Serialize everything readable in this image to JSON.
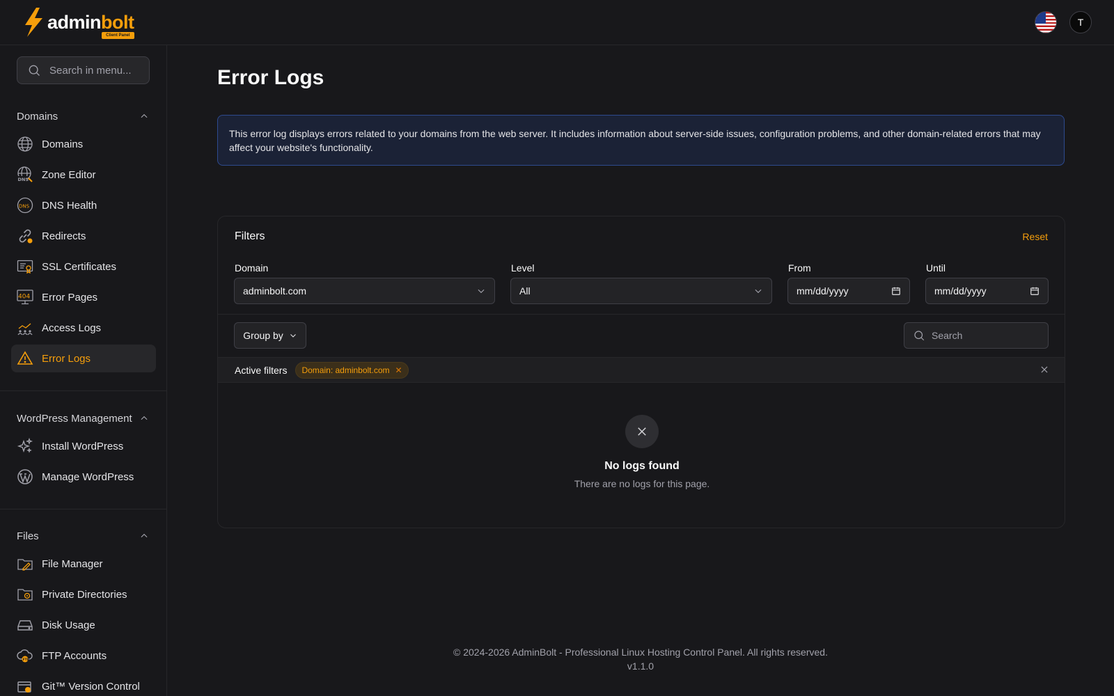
{
  "app": {
    "logo_part1": "admin",
    "logo_part2": "bolt",
    "logo_badge": "Client Panel",
    "avatar_initial": "T",
    "accent_color": "#f59e0b"
  },
  "sidebar": {
    "search_placeholder": "Search in menu...",
    "sections": [
      {
        "title": "Domains",
        "items": [
          {
            "label": "Domains",
            "icon": "globe-icon"
          },
          {
            "label": "Zone Editor",
            "icon": "dns-globe-icon"
          },
          {
            "label": "DNS Health",
            "icon": "dns-health-icon"
          },
          {
            "label": "Redirects",
            "icon": "link-icon"
          },
          {
            "label": "SSL Certificates",
            "icon": "certificate-icon"
          },
          {
            "label": "Error Pages",
            "icon": "error-404-icon"
          },
          {
            "label": "Access Logs",
            "icon": "access-chart-icon"
          },
          {
            "label": "Error Logs",
            "icon": "warning-icon",
            "active": true
          }
        ]
      },
      {
        "title": "WordPress Management",
        "items": [
          {
            "label": "Install WordPress",
            "icon": "sparkles-icon"
          },
          {
            "label": "Manage WordPress",
            "icon": "wordpress-icon"
          }
        ]
      },
      {
        "title": "Files",
        "items": [
          {
            "label": "File Manager",
            "icon": "folder-edit-icon"
          },
          {
            "label": "Private Directories",
            "icon": "folder-lock-icon"
          },
          {
            "label": "Disk Usage",
            "icon": "disk-icon"
          },
          {
            "label": "FTP Accounts",
            "icon": "ftp-cloud-icon"
          },
          {
            "label": "Git™ Version Control",
            "icon": "git-icon"
          }
        ]
      }
    ]
  },
  "main": {
    "title": "Error Logs",
    "info_text": "This error log displays errors related to your domains from the web server. It includes information about server-side issues, configuration problems, and other domain-related errors that may affect your website's functionality.",
    "filters": {
      "heading": "Filters",
      "reset_label": "Reset",
      "domain_label": "Domain",
      "domain_value": "adminbolt.com",
      "level_label": "Level",
      "level_value": "All",
      "from_label": "From",
      "from_placeholder": "mm/dd/yyyy",
      "until_label": "Until",
      "until_placeholder": "mm/dd/yyyy"
    },
    "toolbar": {
      "group_by_label": "Group by",
      "search_placeholder": "Search"
    },
    "active_filters": {
      "label": "Active filters",
      "chips": [
        "Domain: adminbolt.com"
      ]
    },
    "empty": {
      "title": "No logs found",
      "subtitle": "There are no logs for this page."
    },
    "footer": {
      "copyright": "© 2024-2026 AdminBolt - Professional Linux Hosting Control Panel. All rights reserved.",
      "version": "v1.1.0"
    }
  }
}
